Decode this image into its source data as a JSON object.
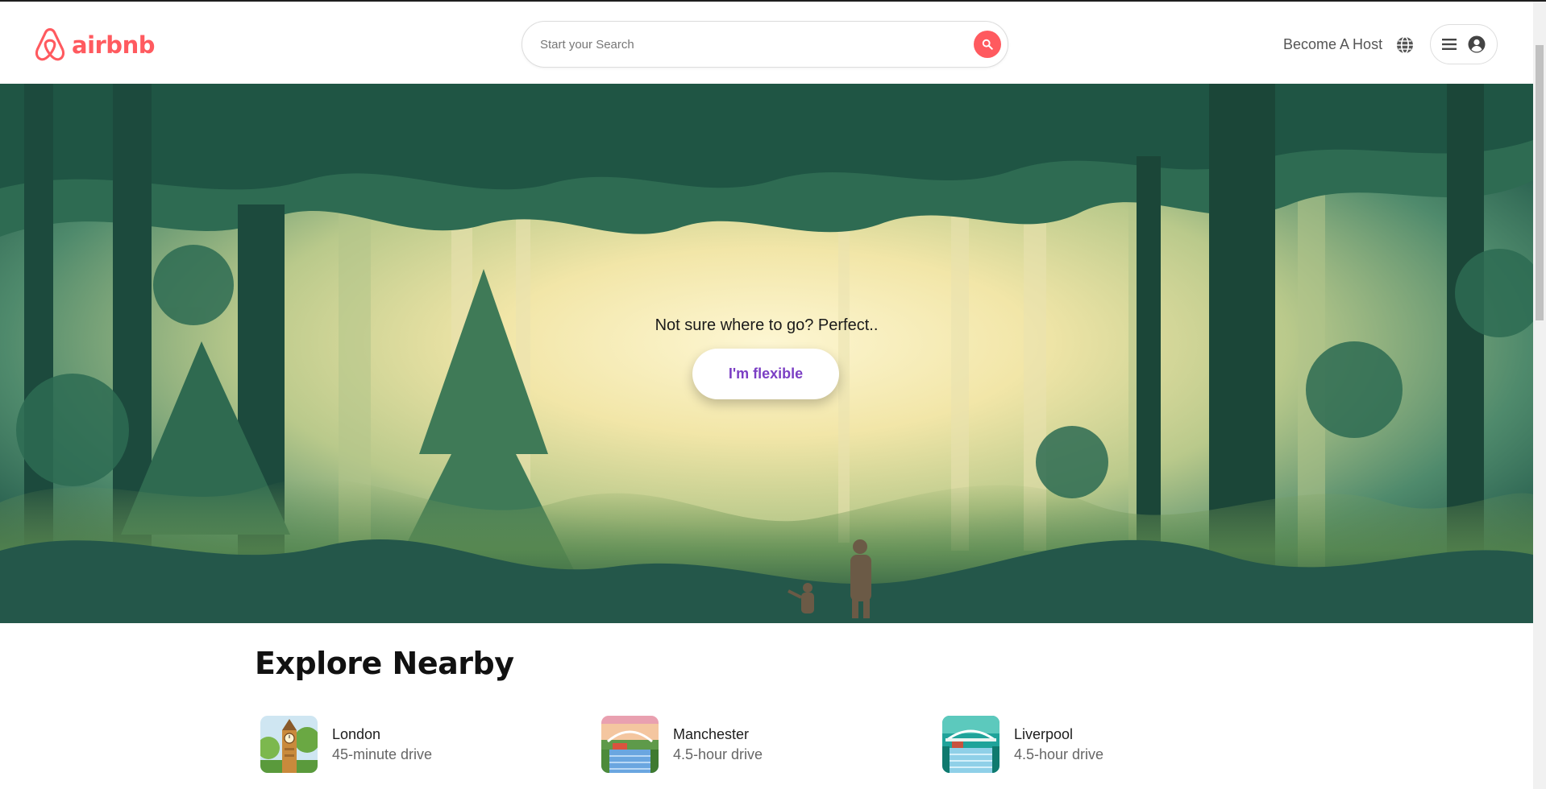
{
  "header": {
    "logo_text": "airbnb",
    "search_placeholder": "Start your Search",
    "become_host": "Become A Host"
  },
  "hero": {
    "headline": "Not sure where to go? Perfect..",
    "button": "I'm flexible"
  },
  "explore": {
    "title": "Explore Nearby",
    "items": [
      {
        "city": "London",
        "drive": "45-minute drive",
        "icon": "big-ben-thumbnail"
      },
      {
        "city": "Manchester",
        "drive": "4.5-hour drive",
        "icon": "bridge-sunset-thumbnail"
      },
      {
        "city": "Liverpool",
        "drive": "4.5-hour drive",
        "icon": "bridge-teal-thumbnail"
      }
    ]
  },
  "colors": {
    "brand": "#ff5a5f",
    "flex_button_text": "#7b3fc4"
  }
}
